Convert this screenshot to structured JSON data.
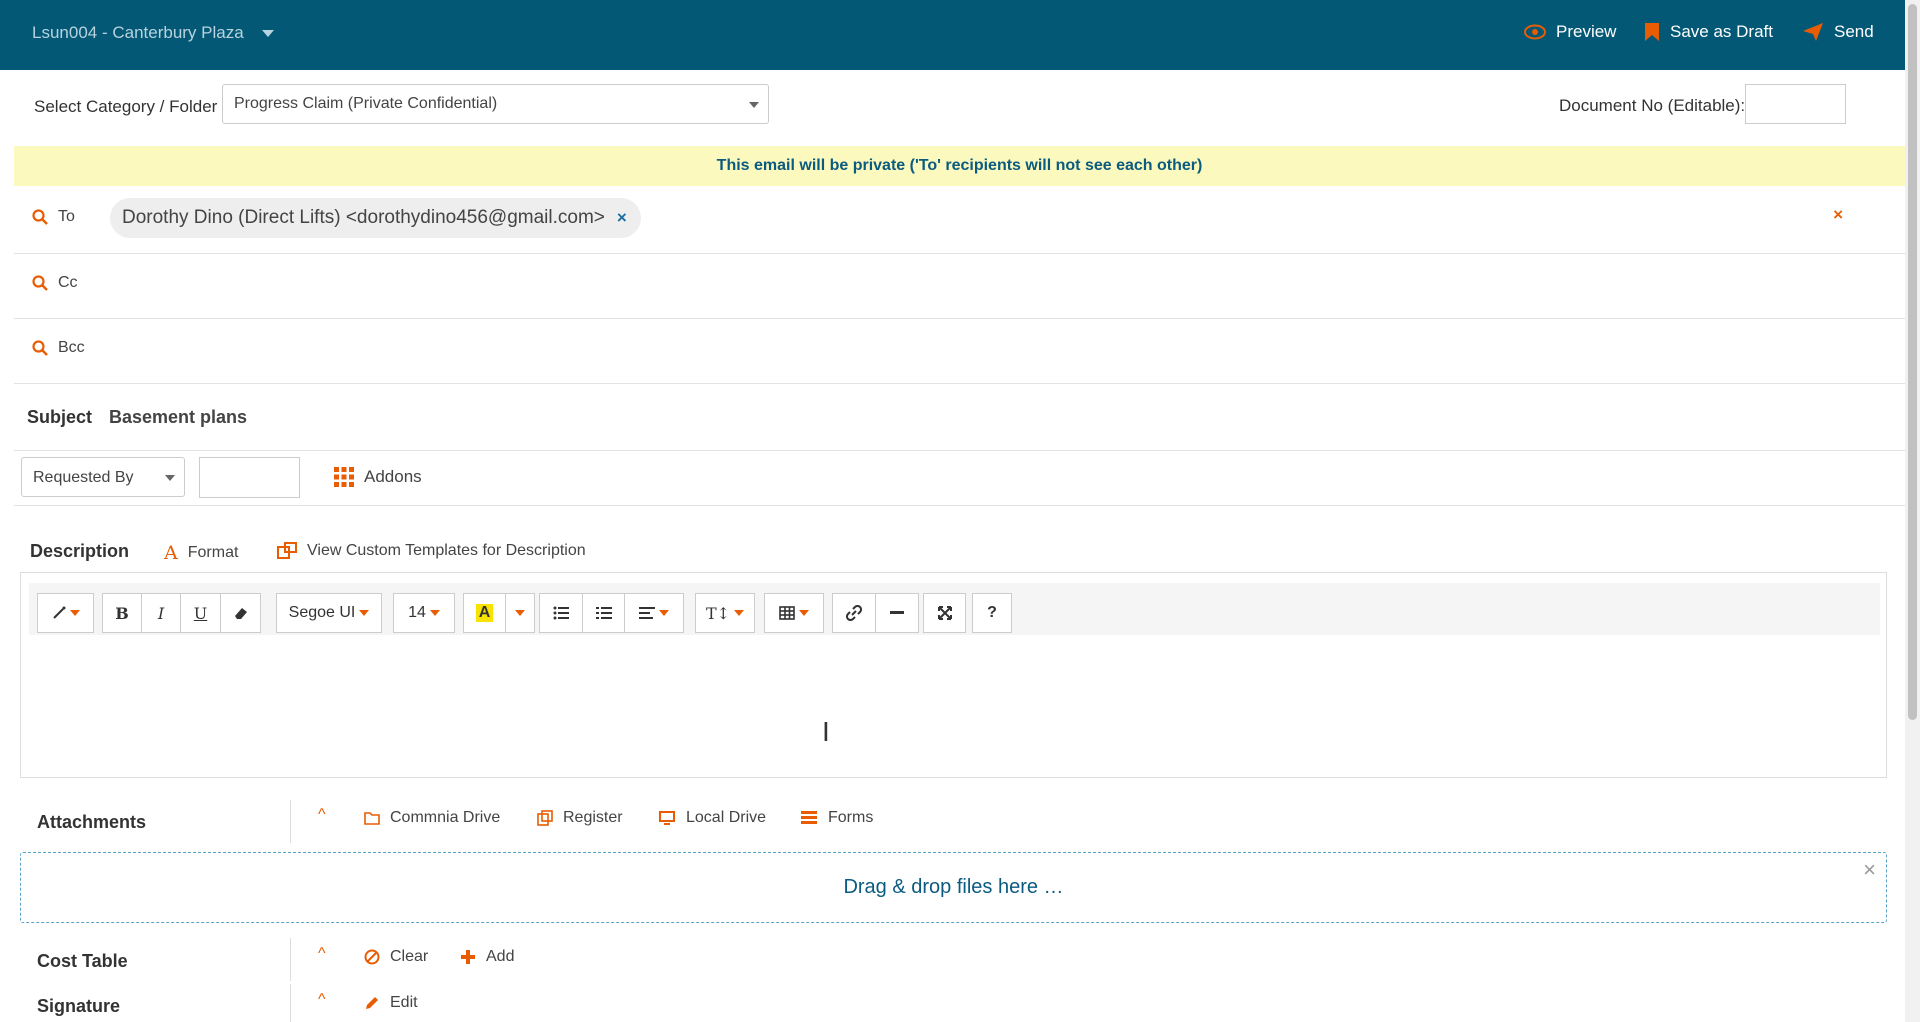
{
  "topbar": {
    "project": "Lsun004 - Canterbury Plaza",
    "preview": "Preview",
    "save_draft": "Save as Draft",
    "send": "Send"
  },
  "category": {
    "label": "Select Category / Folder",
    "value": "Progress Claim (Private Confidential)",
    "doc_no_label": "Document No (Editable):",
    "doc_no_value": ""
  },
  "banner": "This email will be private ('To' recipients will not see each other)",
  "recipients": {
    "to_label": "To",
    "to_chip": "Dorothy Dino (Direct Lifts) <dorothydino456@gmail.com>",
    "chip_remove": "×",
    "clear_all": "×",
    "cc_label": "Cc",
    "bcc_label": "Bcc"
  },
  "subject": {
    "label": "Subject",
    "value": "Basement plans"
  },
  "requested": {
    "select": "Requested By",
    "input": "",
    "addons": "Addons"
  },
  "description": {
    "label": "Description",
    "format": "Format",
    "templates": "View Custom Templates for Description"
  },
  "toolbar": {
    "font": "Segoe UI",
    "size": "14",
    "bold": "B",
    "italic": "I",
    "underline": "U",
    "help": "?"
  },
  "attachments": {
    "label": "Attachments",
    "commnia": "Commnia Drive",
    "register": "Register",
    "local": "Local Drive",
    "forms": "Forms",
    "dropzone": "Drag & drop files here …",
    "dropzone_close": "×"
  },
  "cost_table": {
    "label": "Cost Table",
    "clear": "Clear",
    "add": "Add"
  },
  "signature": {
    "label": "Signature",
    "edit": "Edit"
  },
  "colors": {
    "brand": "#035876",
    "accent": "#e85d04",
    "banner": "#fbf9bd"
  }
}
